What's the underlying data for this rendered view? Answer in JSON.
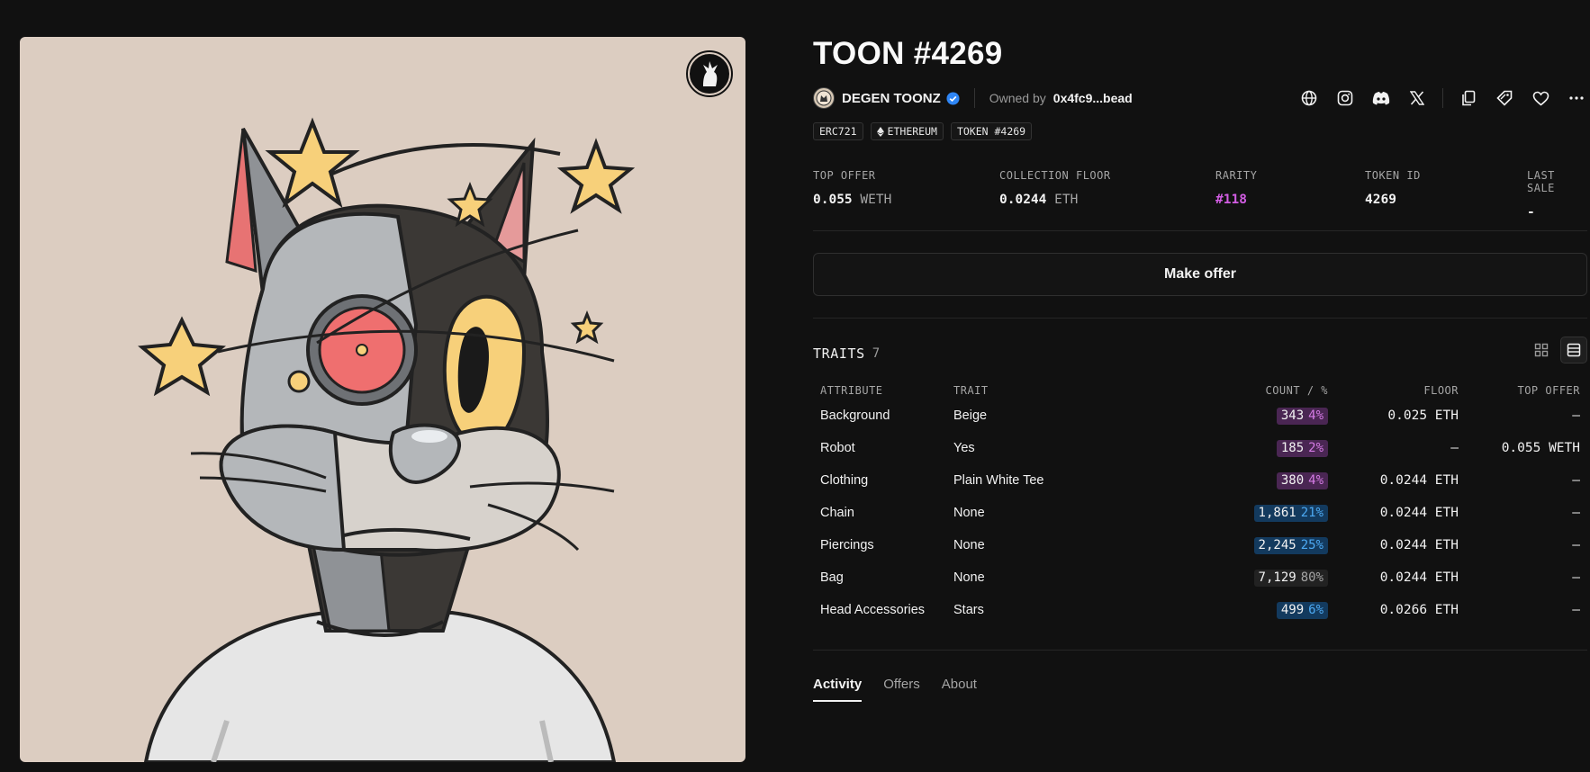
{
  "token": {
    "title": "TOON #4269"
  },
  "collection": {
    "name": "DEGEN TOONZ",
    "owned_label": "Owned by",
    "owner": "0x4fc9...bead"
  },
  "tags": [
    "ERC721",
    "ETHEREUM",
    "TOKEN #4269"
  ],
  "stats": [
    {
      "label": "TOP OFFER",
      "value": "0.055",
      "unit": "WETH"
    },
    {
      "label": "COLLECTION FLOOR",
      "value": "0.0244",
      "unit": "ETH"
    },
    {
      "label": "RARITY",
      "value": "#118",
      "unit": ""
    },
    {
      "label": "TOKEN ID",
      "value": "4269",
      "unit": ""
    },
    {
      "label": "LAST SALE",
      "value": "-",
      "unit": ""
    }
  ],
  "actions": {
    "make_offer": "Make offer"
  },
  "traits": {
    "label": "TRAITS",
    "count": "7",
    "headers": {
      "attribute": "ATTRIBUTE",
      "trait": "TRAIT",
      "count": "COUNT / %",
      "floor": "FLOOR",
      "top_offer": "TOP OFFER"
    },
    "rows": [
      {
        "attribute": "Background",
        "trait": "Beige",
        "count": "343",
        "pct": "4%",
        "color": "purple",
        "floor": "0.025 ETH",
        "top_offer": "—"
      },
      {
        "attribute": "Robot",
        "trait": "Yes",
        "count": "185",
        "pct": "2%",
        "color": "purple",
        "floor": "—",
        "top_offer": "0.055 WETH"
      },
      {
        "attribute": "Clothing",
        "trait": "Plain White Tee",
        "count": "380",
        "pct": "4%",
        "color": "purple",
        "floor": "0.0244 ETH",
        "top_offer": "—"
      },
      {
        "attribute": "Chain",
        "trait": "None",
        "count": "1,861",
        "pct": "21%",
        "color": "blue",
        "floor": "0.0244 ETH",
        "top_offer": "—"
      },
      {
        "attribute": "Piercings",
        "trait": "None",
        "count": "2,245",
        "pct": "25%",
        "color": "blue",
        "floor": "0.0244 ETH",
        "top_offer": "—"
      },
      {
        "attribute": "Bag",
        "trait": "None",
        "count": "7,129",
        "pct": "80%",
        "color": "gray",
        "floor": "0.0244 ETH",
        "top_offer": "—"
      },
      {
        "attribute": "Head Accessories",
        "trait": "Stars",
        "count": "499",
        "pct": "6%",
        "color": "blue",
        "floor": "0.0266 ETH",
        "top_offer": "—"
      }
    ]
  },
  "tabs": [
    {
      "label": "Activity",
      "active": true
    },
    {
      "label": "Offers",
      "active": false
    },
    {
      "label": "About",
      "active": false
    }
  ],
  "icons": [
    "globe-icon",
    "instagram-icon",
    "discord-icon",
    "x-icon",
    "copy-icon",
    "tag-icon",
    "heart-icon",
    "more-icon"
  ],
  "colors": {
    "background": "#111111",
    "art_background": "#dccdc1",
    "rarity": "#d25de3",
    "verified": "#2f86f6"
  }
}
